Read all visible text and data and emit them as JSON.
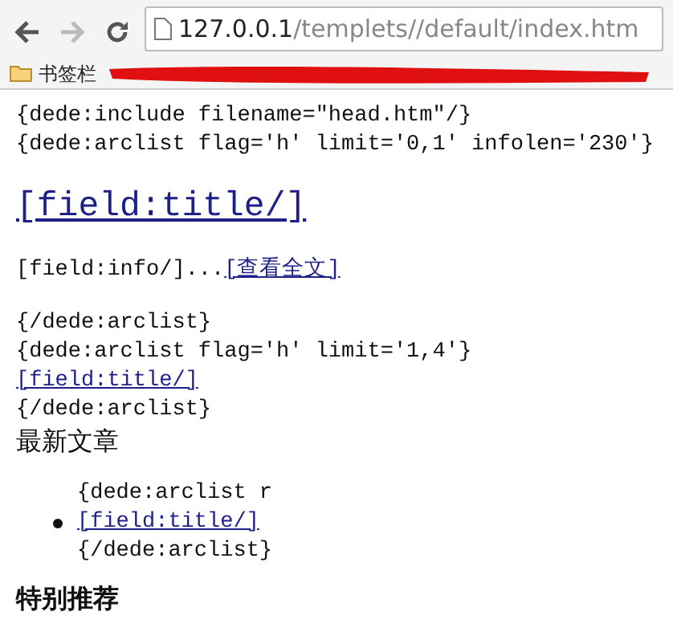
{
  "browser": {
    "back_enabled": true,
    "forward_enabled": false,
    "url_host": "127.0.0.1",
    "url_path": "/templets//default/index.htm",
    "bookmarks_folder": "书签栏"
  },
  "page": [
    {
      "kind": "code",
      "text": "{dede:include filename=\"head.htm\"/}"
    },
    {
      "kind": "code",
      "text": "{dede:arclist flag='h' limit='0,1' infolen='230'}"
    },
    {
      "kind": "title-link",
      "text": "[field:title/]"
    },
    {
      "kind": "info",
      "text": "[field:info/]...",
      "link": "[查看全文]"
    },
    {
      "kind": "code",
      "text": "{/dede:arclist}"
    },
    {
      "kind": "code",
      "text": "{dede:arclist flag='h' limit='1,4'}"
    },
    {
      "kind": "link",
      "text": "[field:title/]"
    },
    {
      "kind": "code",
      "text": "{/dede:arclist}"
    },
    {
      "kind": "label",
      "text": "最新文章"
    },
    {
      "kind": "list",
      "before": "{dede:arclist r",
      "item": "[field:title/]",
      "after": "{/dede:arclist}"
    },
    {
      "kind": "heading",
      "text": "特别推荐"
    }
  ]
}
